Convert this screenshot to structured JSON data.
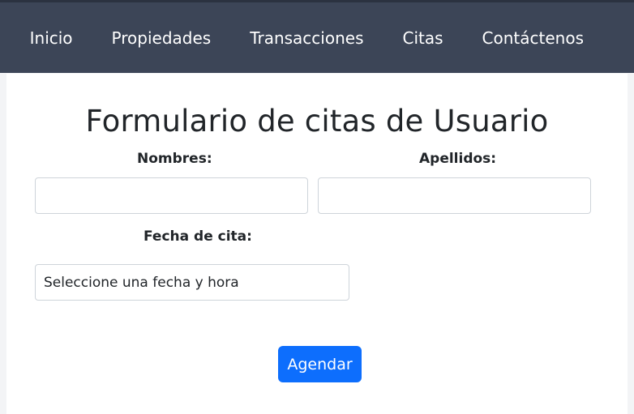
{
  "nav": {
    "items": [
      "Inicio",
      "Propiedades",
      "Transacciones",
      "Citas",
      "Contáctenos"
    ]
  },
  "form": {
    "title": "Formulario de citas de Usuario",
    "first_name_label": "Nombres:",
    "first_name_value": "",
    "last_name_label": "Apellidos:",
    "last_name_value": "",
    "date_label": "Fecha de cita:",
    "date_placeholder": "Seleccione una fecha y hora",
    "submit_label": "Agendar"
  },
  "colors": {
    "nav_background": "#3c4557",
    "button_primary": "#0d6efd"
  }
}
